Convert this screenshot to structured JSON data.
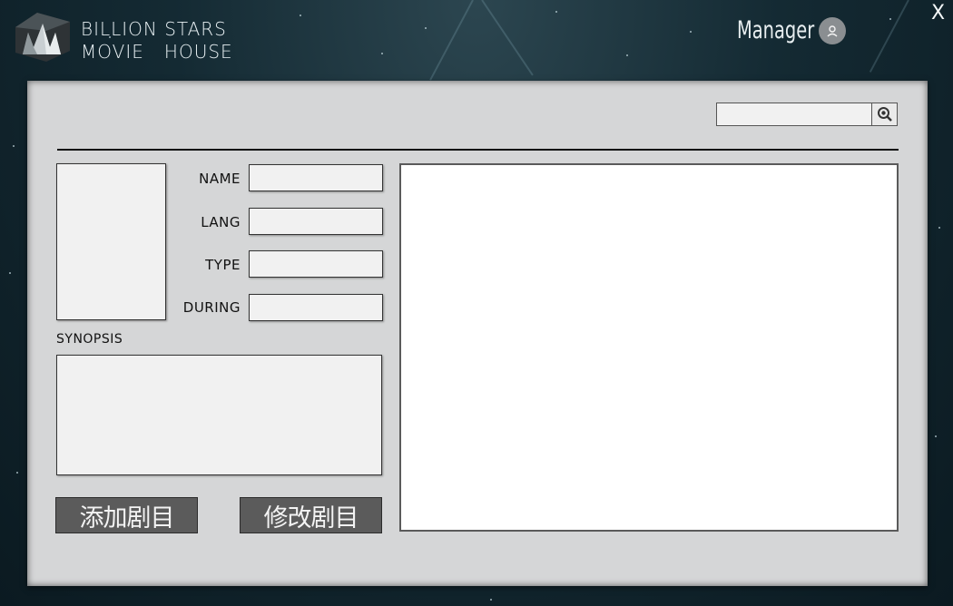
{
  "app": {
    "brand_line1": "BILLION STARS",
    "brand_line2": "MOVIE   HOUSE",
    "user_name": "Manager",
    "close_label": "X"
  },
  "search": {
    "value": "",
    "placeholder": ""
  },
  "form": {
    "name_label": "NAME",
    "lang_label": "LANG",
    "type_label": "TYPE",
    "during_label": "DURING",
    "synopsis_label": "SYNOPSIS",
    "name_value": "",
    "lang_value": "",
    "type_value": "",
    "during_value": "",
    "synopsis_value": ""
  },
  "actions": {
    "add_label": "添加剧目",
    "modify_label": "修改剧目"
  },
  "icons": {
    "search": "search-icon",
    "avatar": "user-icon",
    "logo": "crown-logo-icon"
  },
  "colors": {
    "panel_bg": "#d5d6d7",
    "button_bg": "#5b5b5b",
    "field_bg": "#f1f1f1"
  }
}
